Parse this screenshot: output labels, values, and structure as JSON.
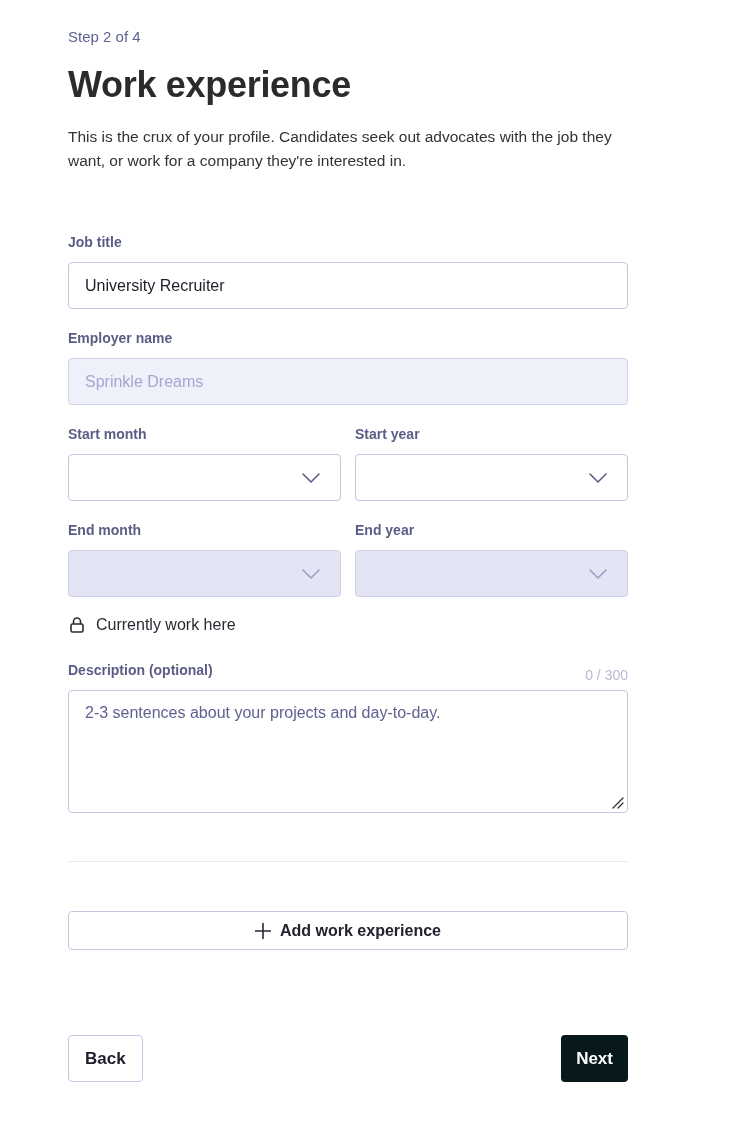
{
  "header": {
    "step": "Step 2 of 4",
    "title": "Work experience",
    "description": "This is the crux of your profile. Candidates seek out advocates with the job they want, or work for a company they're interested in."
  },
  "text_fields": [
    {
      "label": "Job title",
      "value": "University Recruiter",
      "disabled": false
    },
    {
      "label": "Employer name",
      "value": "Sprinkle Dreams",
      "disabled": true
    }
  ],
  "date_fields": [
    {
      "label": "Start month",
      "disabled": false
    },
    {
      "label": "Start year",
      "disabled": false
    },
    {
      "label": "End month",
      "disabled": true
    },
    {
      "label": "End year",
      "disabled": true
    }
  ],
  "current_job": {
    "label": "Currently work here"
  },
  "description": {
    "label": "Description (optional)",
    "counter": "0 / 300",
    "placeholder": "2-3 sentences about your projects and day-to-day."
  },
  "add_button": {
    "label": "Add work experience"
  },
  "footer": {
    "back": "Back",
    "next": "Next"
  }
}
